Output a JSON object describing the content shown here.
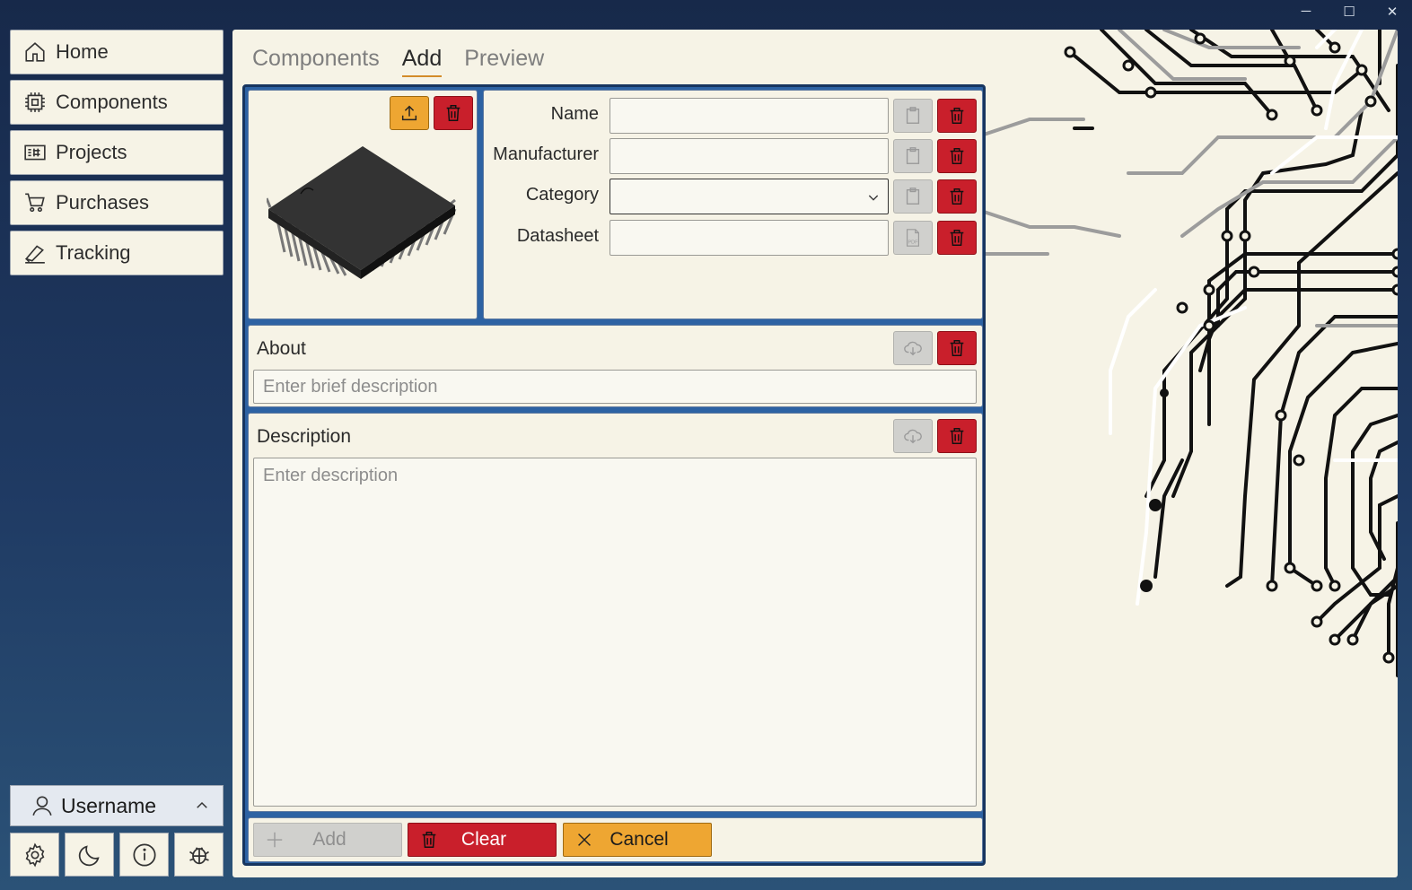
{
  "window": {
    "controls": [
      "─",
      "☐",
      "✕"
    ]
  },
  "sidebar": {
    "items": [
      {
        "label": "Home",
        "icon": "home-icon"
      },
      {
        "label": "Components",
        "icon": "chip-icon"
      },
      {
        "label": "Projects",
        "icon": "board-icon"
      },
      {
        "label": "Purchases",
        "icon": "cart-icon"
      },
      {
        "label": "Tracking",
        "icon": "tracking-icon"
      }
    ],
    "user": {
      "name": "Username",
      "icon": "user-icon"
    },
    "tools": [
      "settings-icon",
      "moon-icon",
      "info-icon",
      "bug-icon"
    ]
  },
  "tabs": [
    {
      "label": "Components",
      "active": false
    },
    {
      "label": "Add",
      "active": true
    },
    {
      "label": "Preview",
      "active": false
    }
  ],
  "form": {
    "fields": [
      {
        "label": "Name",
        "value": "",
        "side_icon": "clipboard-icon"
      },
      {
        "label": "Manufacturer",
        "value": "",
        "side_icon": "clipboard-icon"
      },
      {
        "label": "Category",
        "value": "",
        "side_icon": "clipboard-icon",
        "type": "select"
      },
      {
        "label": "Datasheet",
        "value": "",
        "side_icon": "pdf-icon"
      }
    ],
    "about": {
      "title": "About",
      "placeholder": "Enter brief description"
    },
    "description": {
      "title": "Description",
      "placeholder": "Enter description"
    }
  },
  "actions": {
    "add_label": "Add",
    "clear_label": "Clear",
    "cancel_label": "Cancel"
  },
  "colors": {
    "accent_orange": "#eea632",
    "danger_red": "#c91f2b",
    "frame_blue": "#2d62a3",
    "panel_bg": "#f6f3e6",
    "sidebar_bg": "#1f3a63"
  }
}
